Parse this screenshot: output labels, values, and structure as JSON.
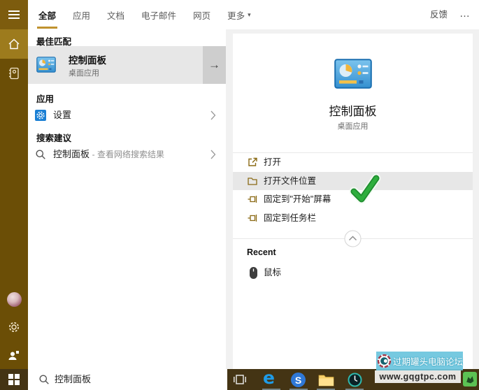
{
  "topbar": {
    "tabs": [
      {
        "label": "全部",
        "active": true
      },
      {
        "label": "应用",
        "active": false
      },
      {
        "label": "文档",
        "active": false
      },
      {
        "label": "电子邮件",
        "active": false
      },
      {
        "label": "网页",
        "active": false
      },
      {
        "label": "更多",
        "active": false,
        "dropdown": true
      }
    ],
    "more_caret": "▾",
    "feedback": "反馈",
    "overflow": "…"
  },
  "sidebar": {
    "items": [
      {
        "icon": "home-icon",
        "active": true
      },
      {
        "icon": "notebook-icon",
        "active": false
      }
    ],
    "bottom_items": [
      {
        "icon": "avatar"
      },
      {
        "icon": "gear-icon"
      },
      {
        "icon": "person-share-icon"
      }
    ]
  },
  "left_panel": {
    "best_match_header": "最佳匹配",
    "best_match": {
      "title": "控制面板",
      "subtitle": "桌面应用",
      "arrow": "→",
      "icon": "control-panel-icon"
    },
    "apps_header": "应用",
    "apps": [
      {
        "label": "设置",
        "icon": "settings-blue-icon"
      }
    ],
    "suggestions_header": "搜索建议",
    "suggestions": [
      {
        "label": "控制面板",
        "hint": "- 查看网络搜索结果",
        "icon": "search-icon"
      }
    ]
  },
  "right_panel": {
    "title": "控制面板",
    "subtitle": "桌面应用",
    "icon": "control-panel-icon",
    "actions": [
      {
        "label": "打开",
        "icon": "open-icon",
        "highlighted": false
      },
      {
        "label": "打开文件位置",
        "icon": "folder-location-icon",
        "highlighted": true
      },
      {
        "label": "固定到\"开始\"屏幕",
        "icon": "pin-icon",
        "highlighted": false
      },
      {
        "label": "固定到任务栏",
        "icon": "pin-icon",
        "highlighted": false
      }
    ],
    "collapse_icon": "chevron-up-icon",
    "recent_header": "Recent",
    "recent": [
      {
        "label": "鼠标",
        "icon": "mouse-icon"
      }
    ],
    "annotation": "green-checkmark"
  },
  "taskbar": {
    "search_value": "控制面板",
    "edge_glyph": "e",
    "sogou_glyph": "S",
    "icons": [
      "task-view-icon",
      "edge-icon",
      "sogou-browser-icon",
      "file-explorer-icon",
      "clock-app-icon",
      "green-app-icon"
    ]
  },
  "watermark": {
    "line1": "过期罐头电脑论坛",
    "line2": "www.gqgtpc.com"
  },
  "colors": {
    "accent": "#c0922f",
    "sidebarBg": "#6b4e06",
    "hamburgerBg": "#7d5c0e",
    "activeItemBg": "#9d7b1d",
    "taskbarBg": "#443414",
    "canvasBg": "#f1f1f1",
    "rowHighlight": "#e7e7e7",
    "arrowBtnBg": "#cecece",
    "settingsBlue": "#1a7fd4",
    "actionIcon": "#8a6a14",
    "checkGreen": "#2fae3e",
    "watermarkBlue": "#6cc5de"
  }
}
